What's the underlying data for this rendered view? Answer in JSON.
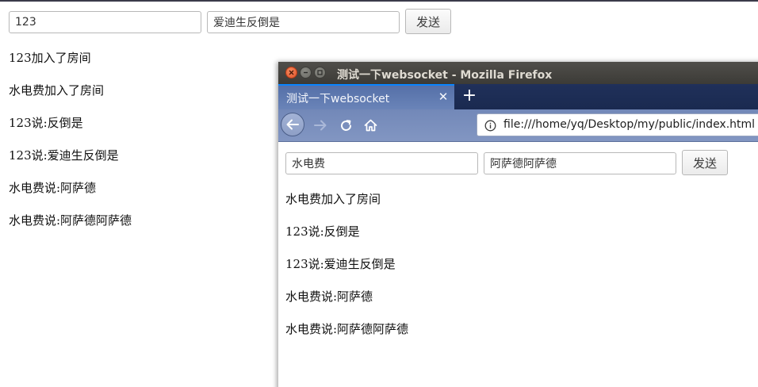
{
  "bg_page": {
    "username_value": "123",
    "message_value": "爱迪生反倒是",
    "send_label": "发送",
    "messages": [
      "123加入了房间",
      "水电费加入了房间",
      "123说:反倒是",
      "123说:爱迪生反倒是",
      "水电费说:阿萨德",
      "水电费说:阿萨德阿萨德"
    ]
  },
  "firefox": {
    "window_title": "测试一下websocket - Mozilla Firefox",
    "tab_title": "测试一下websocket",
    "tab_close": "✕",
    "new_tab": "+",
    "url": "file:///home/yq/Desktop/my/public/index.html",
    "page": {
      "username_value": "水电费",
      "message_value": "阿萨德阿萨德",
      "send_label": "发送",
      "messages": [
        "水电费加入了房间",
        "123说:反倒是",
        "123说:爱迪生反倒是",
        "水电费说:阿萨德",
        "水电费说:阿萨德阿萨德"
      ]
    }
  },
  "icons": {
    "window_close": "close-icon",
    "window_minimize": "minimize-icon",
    "window_maximize": "maximize-icon",
    "back": "back-arrow-icon",
    "forward": "forward-arrow-icon",
    "reload": "reload-icon",
    "home": "home-icon",
    "site_info": "info-icon"
  },
  "colors": {
    "tab_accent": "#0a84ff",
    "titlebar": "#3c3b37",
    "tabstrip": "#1a2a50",
    "close_button": "#e0522a"
  }
}
